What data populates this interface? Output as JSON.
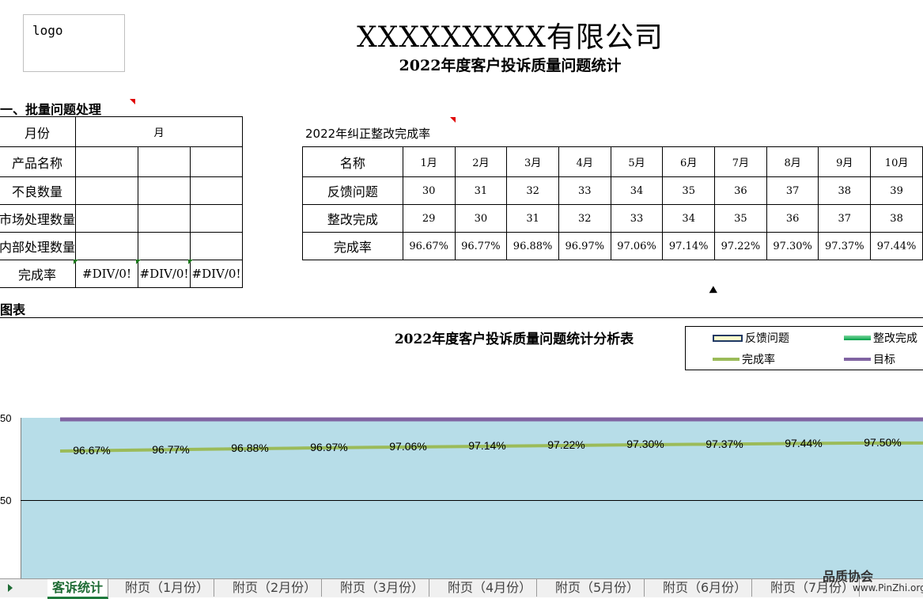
{
  "header": {
    "logo_text": "logo",
    "company": "XXXXXXXXX有限公司",
    "subtitle": "2022年度客户投诉质量问题统计"
  },
  "batch_section": {
    "title": "一、批量问题处理",
    "rows": [
      {
        "label": "月份",
        "cells": [
          "月"
        ]
      },
      {
        "label": "产品名称",
        "cells": [
          "",
          "",
          ""
        ]
      },
      {
        "label": "不良数量",
        "cells": [
          "",
          "",
          ""
        ]
      },
      {
        "label": "市场处理数量",
        "cells": [
          "",
          "",
          ""
        ]
      },
      {
        "label": "内部处理数量",
        "cells": [
          "",
          "",
          ""
        ]
      },
      {
        "label": "完成率",
        "cells": [
          "#DIV/0!",
          "#DIV/0!",
          "#DIV/0!"
        ]
      }
    ]
  },
  "rate_section": {
    "title": "2022年纠正整改完成率",
    "header": [
      "名称",
      "1月",
      "2月",
      "3月",
      "4月",
      "5月",
      "6月",
      "7月",
      "8月",
      "9月",
      "10月"
    ],
    "rows": [
      {
        "label": "反馈问题",
        "values": [
          "30",
          "31",
          "32",
          "33",
          "34",
          "35",
          "36",
          "37",
          "38",
          "39"
        ]
      },
      {
        "label": "整改完成",
        "values": [
          "29",
          "30",
          "31",
          "32",
          "33",
          "34",
          "35",
          "36",
          "37",
          "38"
        ]
      },
      {
        "label": "完成率",
        "values": [
          "96.67%",
          "96.77%",
          "96.88%",
          "96.97%",
          "97.06%",
          "97.14%",
          "97.22%",
          "97.30%",
          "97.37%",
          "97.44%"
        ]
      }
    ]
  },
  "chart_section": {
    "title": "图表"
  },
  "chart_data": {
    "type": "line",
    "title": "2022年度客户投诉质量问题统计分析表",
    "legend": {
      "placement": "top-right",
      "items": [
        {
          "name": "反馈问题",
          "color": "#1f3864"
        },
        {
          "name": "整改完成",
          "color": "#00b050"
        },
        {
          "name": "完成率",
          "color": "#9bbb59"
        },
        {
          "name": "目标",
          "color": "#8064a2"
        }
      ]
    },
    "y_ticks": [
      "50",
      "50"
    ],
    "completion_rate_labels": [
      "96.67%",
      "96.77%",
      "96.88%",
      "96.97%",
      "97.06%",
      "97.14%",
      "97.22%",
      "97.30%",
      "97.37%",
      "97.44%",
      "97.50%"
    ],
    "completion_rate_values": [
      96.67,
      96.77,
      96.88,
      96.97,
      97.06,
      97.14,
      97.22,
      97.3,
      97.37,
      97.44,
      97.5
    ],
    "target_value": 100,
    "plot_background": "#b7dde8",
    "line_color": "#9bbb59",
    "target_color": "#8064a2"
  },
  "sheet_tabs": {
    "active": "客诉统计",
    "items": [
      "客诉统计",
      "附页（1月份）",
      "附页（2月份）",
      "附页（3月份）",
      "附页（4月份）",
      "附页（5月份）",
      "附页（6月份）",
      "附页（7月份）"
    ]
  },
  "watermark": {
    "text": "品质协会",
    "sub": "www.PinZhi.org"
  }
}
